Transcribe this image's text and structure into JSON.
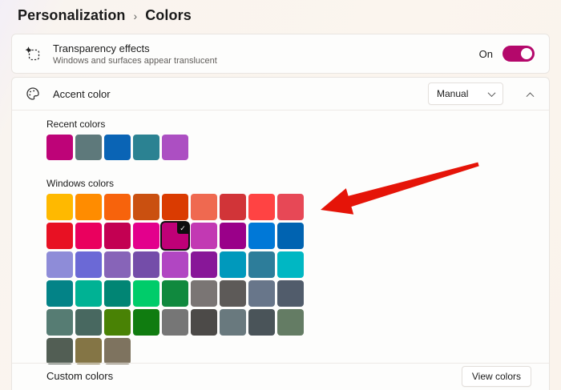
{
  "breadcrumb": {
    "items": [
      {
        "label": "Personalization"
      },
      {
        "label": "Colors"
      }
    ],
    "separator": "›"
  },
  "transparency_card": {
    "title": "Transparency effects",
    "subtitle": "Windows and surfaces appear translucent",
    "toggle_label": "On",
    "toggle_state": "on"
  },
  "accent_card": {
    "title": "Accent color",
    "dropdown_value": "Manual",
    "recent": {
      "label": "Recent colors",
      "colors": [
        "#BE0378",
        "#5E797B",
        "#0A64B5",
        "#2B8292",
        "#AC4FC2"
      ]
    },
    "windows": {
      "label": "Windows colors",
      "colors": [
        "#FFB900",
        "#FF8C00",
        "#F7630C",
        "#CA5010",
        "#DA3B01",
        "#EF6950",
        "#D13438",
        "#FF4343",
        "#E74856",
        "#E81123",
        "#EA005E",
        "#C30052",
        "#E3008C",
        "#BF0077",
        "#C239B3",
        "#9A0089",
        "#0078D7",
        "#0063B1",
        "#8E8CD8",
        "#6B69D6",
        "#8764B8",
        "#744DA9",
        "#B146C2",
        "#881798",
        "#0099BC",
        "#2D7D9A",
        "#00B7C3",
        "#038387",
        "#00B294",
        "#018574",
        "#00CC6A",
        "#10893E",
        "#7A7574",
        "#5D5A58",
        "#68768A",
        "#515C6B",
        "#567C73",
        "#486860",
        "#498205",
        "#107C10",
        "#767676",
        "#4C4A48",
        "#69797E",
        "#4A5459",
        "#647C64",
        "#525E54",
        "#847545",
        "#7E735F"
      ],
      "selected_index": 13,
      "check_glyph": "✓"
    },
    "custom": {
      "label": "Custom colors",
      "button_label": "View colors"
    }
  },
  "annotation": {
    "arrow_color": "#E51408"
  },
  "theme": {
    "accent": "#B4086B"
  }
}
